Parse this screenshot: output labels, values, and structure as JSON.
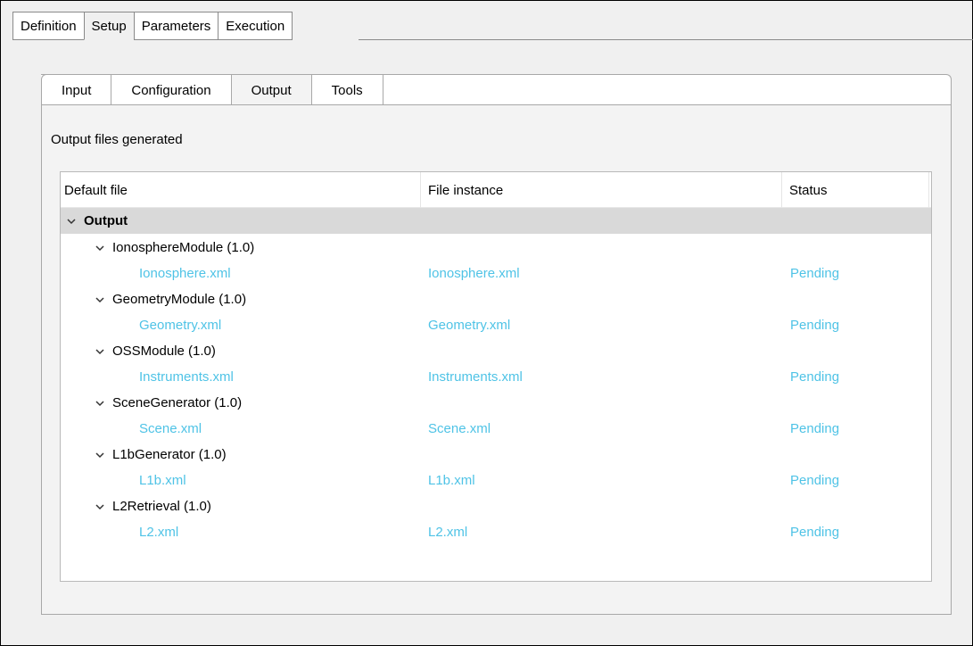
{
  "outer_tabs": [
    {
      "label": "Definition"
    },
    {
      "label": "Setup"
    },
    {
      "label": "Parameters"
    },
    {
      "label": "Execution"
    }
  ],
  "inner_tabs": [
    {
      "label": "Input"
    },
    {
      "label": "Configuration"
    },
    {
      "label": "Output"
    },
    {
      "label": "Tools"
    }
  ],
  "section_title": "Output files generated",
  "table": {
    "columns": [
      "Default file",
      "File instance",
      "Status"
    ],
    "root": "Output",
    "modules": [
      {
        "name": "IonosphereModule (1.0)",
        "default_file": "Ionosphere.xml",
        "file_instance": "Ionosphere.xml",
        "status": "Pending"
      },
      {
        "name": "GeometryModule (1.0)",
        "default_file": "Geometry.xml",
        "file_instance": "Geometry.xml",
        "status": "Pending"
      },
      {
        "name": "OSSModule (1.0)",
        "default_file": "Instruments.xml",
        "file_instance": "Instruments.xml",
        "status": "Pending"
      },
      {
        "name": "SceneGenerator (1.0)",
        "default_file": "Scene.xml",
        "file_instance": "Scene.xml",
        "status": "Pending"
      },
      {
        "name": "L1bGenerator (1.0)",
        "default_file": "L1b.xml",
        "file_instance": "L1b.xml",
        "status": "Pending"
      },
      {
        "name": "L2Retrieval (1.0)",
        "default_file": "L2.xml",
        "file_instance": "L2.xml",
        "status": "Pending"
      }
    ]
  },
  "colors": {
    "file_link": "#4fc3e6",
    "root_row_bg": "#d9d9d9"
  }
}
